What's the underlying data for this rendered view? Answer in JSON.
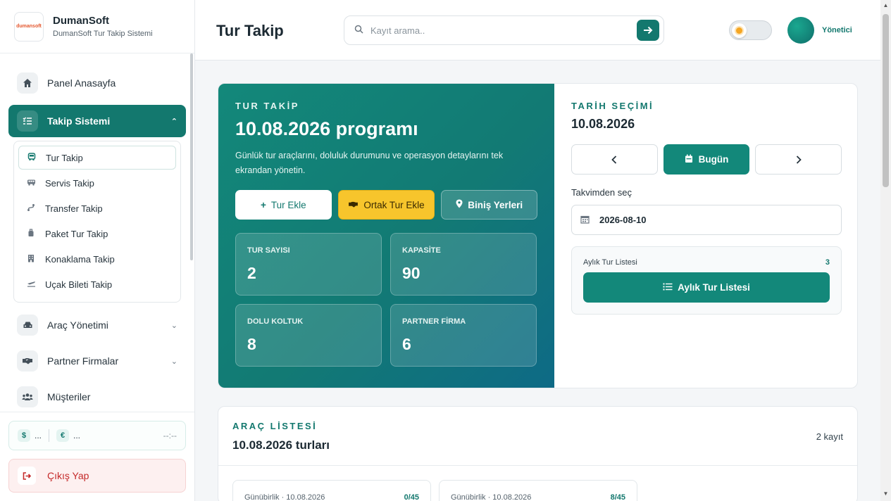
{
  "brand": {
    "logo_text": "dumansoft",
    "name": "DumanSoft",
    "subtitle": "DumanSoft Tur Takip Sistemi"
  },
  "sidebar": {
    "items": [
      {
        "label": "Panel Anasayfa",
        "icon": "home-icon"
      },
      {
        "label": "Takip Sistemi",
        "icon": "list-check-icon",
        "expanded": true
      },
      {
        "label": "Araç Yönetimi",
        "icon": "car-icon"
      },
      {
        "label": "Partner Firmalar",
        "icon": "handshake-icon"
      },
      {
        "label": "Müşteriler",
        "icon": "users-icon"
      }
    ],
    "subitems": [
      {
        "label": "Tur Takip",
        "icon": "bus-icon"
      },
      {
        "label": "Servis Takip",
        "icon": "van-icon"
      },
      {
        "label": "Transfer Takip",
        "icon": "route-icon"
      },
      {
        "label": "Paket Tur Takip",
        "icon": "suitcase-icon"
      },
      {
        "label": "Konaklama Takip",
        "icon": "hotel-icon"
      },
      {
        "label": "Uçak Bileti Takip",
        "icon": "plane-icon"
      }
    ],
    "currency": {
      "usd_symbol": "$",
      "usd_value": "...",
      "eur_symbol": "€",
      "eur_value": "...",
      "time": "--:--"
    },
    "logout_label": "Çıkış Yap"
  },
  "header": {
    "title": "Tur Takip",
    "search_placeholder": "Kayıt arama..",
    "user_name": "Yönetici"
  },
  "hero": {
    "eyebrow": "TUR TAKİP",
    "title": "10.08.2026 programı",
    "description": "Günlük tur araçlarını, doluluk durumunu ve operasyon detaylarını tek ekrandan yönetin.",
    "buttons": {
      "add_tour": "Tur Ekle",
      "add_joint_tour": "Ortak Tur Ekle",
      "pickup_points": "Biniş Yerleri"
    },
    "stats": [
      {
        "label": "TUR SAYISI",
        "value": "2"
      },
      {
        "label": "KAPASİTE",
        "value": "90"
      },
      {
        "label": "DOLU KOLTUK",
        "value": "8"
      },
      {
        "label": "PARTNER FİRMA",
        "value": "6"
      }
    ]
  },
  "date_panel": {
    "eyebrow": "TARİH SEÇİMİ",
    "selected_date": "10.08.2026",
    "today_label": "Bugün",
    "calendar_label": "Takvimden seç",
    "date_value": "2026-08-10",
    "monthly_label": "Aylık Tur Listesi",
    "monthly_count": "3",
    "monthly_button": "Aylık Tur Listesi"
  },
  "vehicles": {
    "eyebrow": "ARAÇ LİSTESİ",
    "title": "10.08.2026 turları",
    "count": "2 kayıt",
    "cards": [
      {
        "label": "Günübirlik · 10.08.2026",
        "occupancy": "0/45"
      },
      {
        "label": "Günübirlik · 10.08.2026",
        "occupancy": "8/45"
      }
    ]
  },
  "colors": {
    "primary": "#13786e",
    "accent_yellow": "#f7c52c",
    "danger": "#c52a2a"
  }
}
